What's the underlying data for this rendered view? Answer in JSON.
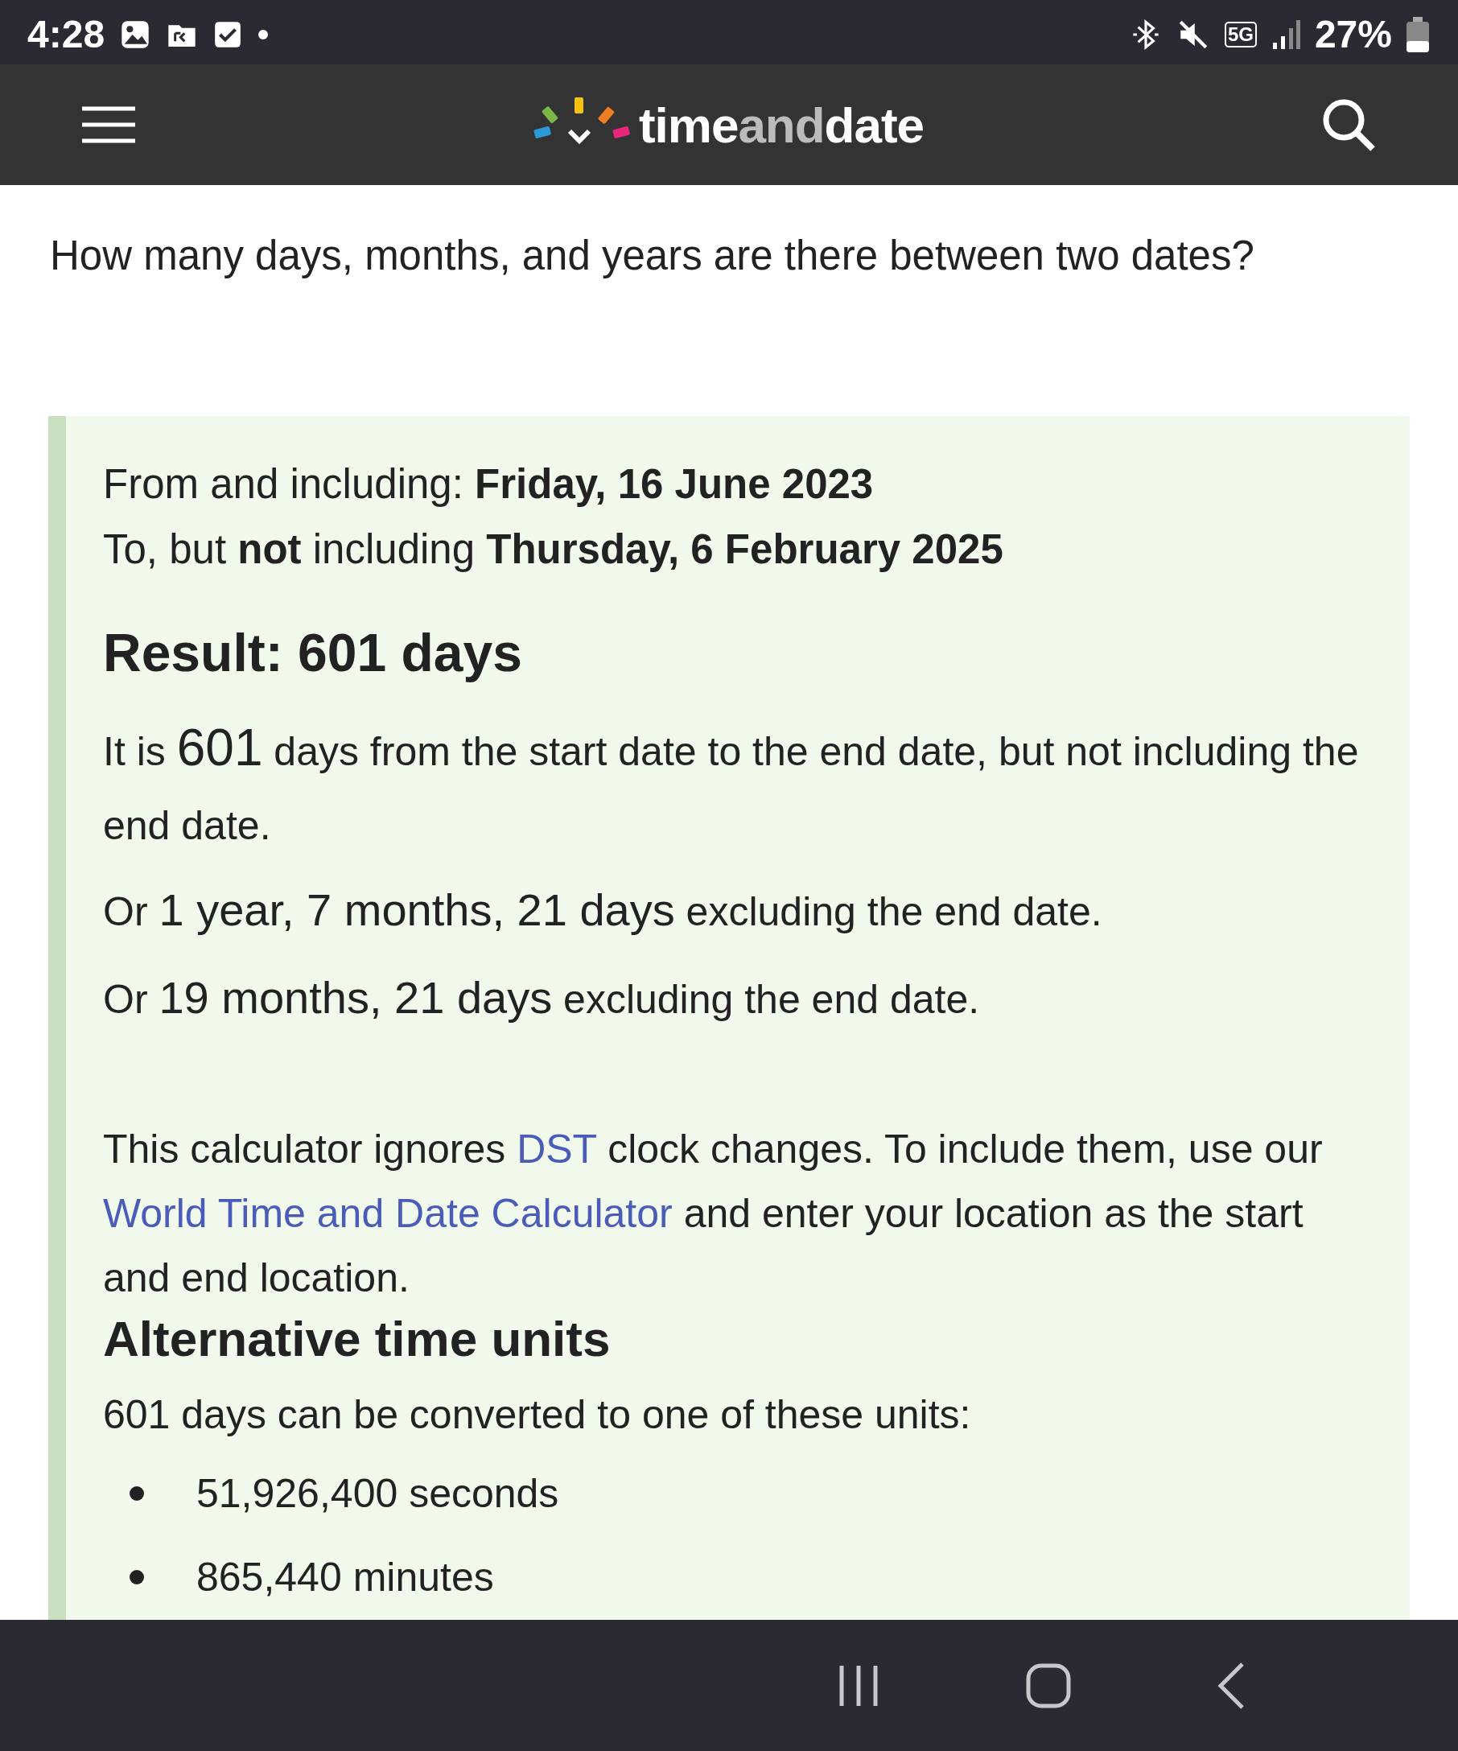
{
  "status_bar": {
    "time": "4:28",
    "network": "5G",
    "battery": "27%"
  },
  "header": {
    "brand": [
      "time",
      "and",
      "date"
    ]
  },
  "page": {
    "subtitle": "How many days, months, and years are there between two dates?"
  },
  "result_box": {
    "from": {
      "label": "From and including:",
      "date": "Friday, 16 June 2023"
    },
    "to": {
      "label": "To, but **not** including",
      "date": "Thursday, 6 February 2025"
    },
    "result_heading": "Result: 601 days",
    "statements": [
      {
        "lead": "It is",
        "amount": "601",
        "rest": "days from the start date to the end date, but not including the end date."
      },
      {
        "lead": "Or",
        "amount": "1 year, 7 months, 21 days",
        "rest": "excluding the end date."
      },
      {
        "lead": "Or",
        "amount": "19 months, 21 days",
        "rest": "excluding the end date."
      }
    ],
    "note": [
      {
        "kind": "text",
        "text": "This calculator ignores"
      },
      {
        "kind": "link",
        "text": "DST"
      },
      {
        "kind": "text",
        "text": "clock changes. To include them, use our"
      },
      {
        "kind": "link",
        "text": "World Time and Date Calculator"
      },
      {
        "kind": "text",
        "text": "and enter your location as the start and end location."
      }
    ],
    "alt_heading": "Alternative time units",
    "alt_intro": "601 days can be converted to one of these units:",
    "units": [
      "51,926,400 seconds",
      "865,440 minutes"
    ]
  }
}
